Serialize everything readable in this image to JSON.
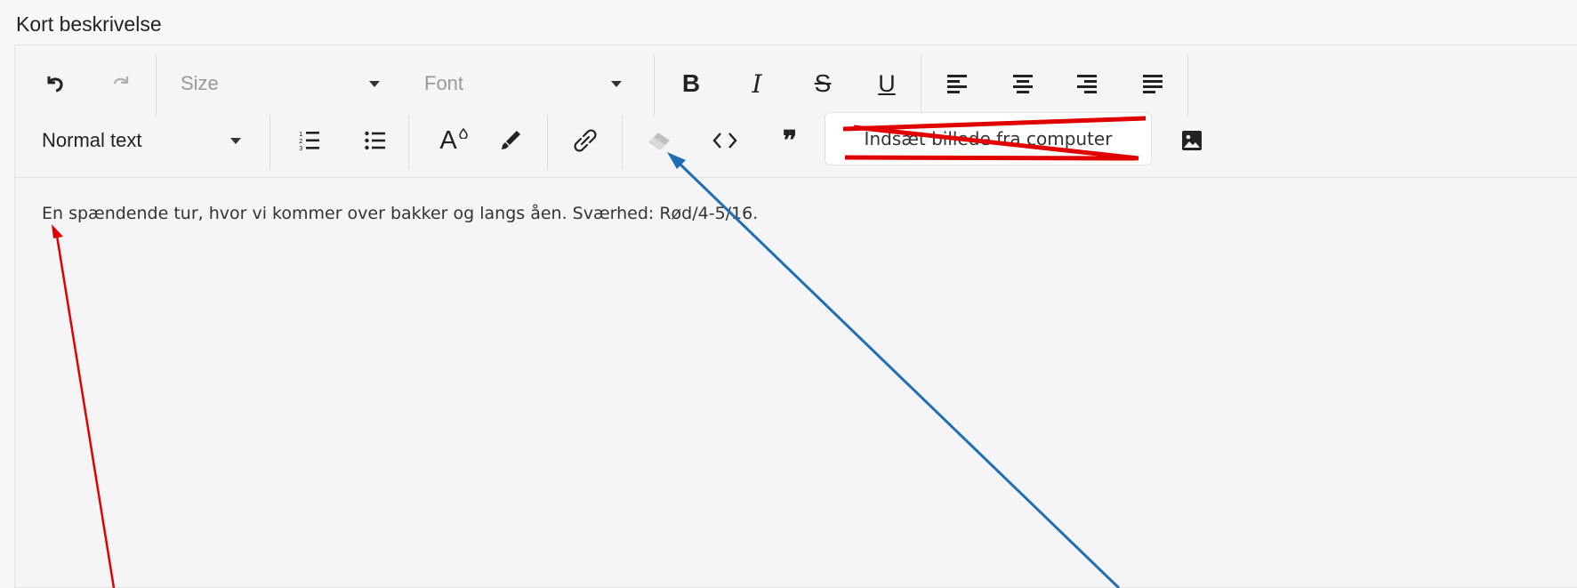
{
  "label": "Kort beskrivelse",
  "toolbar": {
    "size_placeholder": "Size",
    "font_placeholder": "Font",
    "bold": "B",
    "italic": "I",
    "strike": "S",
    "underline": "U",
    "font_color_label": "A",
    "paragraph_style": "Normal text",
    "quote": "❞",
    "upload_image_label": "Indsæt billede fra computer"
  },
  "content": {
    "text": "En spændende tur, hvor vi kommer over bakker og langs åen. Sværhed: Rød/4-5/16."
  },
  "icons": [
    "undo-icon",
    "redo-icon",
    "bold-icon",
    "italic-icon",
    "strikethrough-icon",
    "underline-icon",
    "align-left-icon",
    "align-center-icon",
    "align-right-icon",
    "align-justify-icon",
    "ordered-list-icon",
    "unordered-list-icon",
    "font-color-icon",
    "highlight-icon",
    "link-icon",
    "eraser-icon",
    "code-icon",
    "quote-icon",
    "image-icon"
  ],
  "colors": {
    "cross_out": "#e00000",
    "blue_arrow": "#1f6eb5",
    "red_arrow": "#e00000",
    "disabled": "#b0b0b0"
  }
}
